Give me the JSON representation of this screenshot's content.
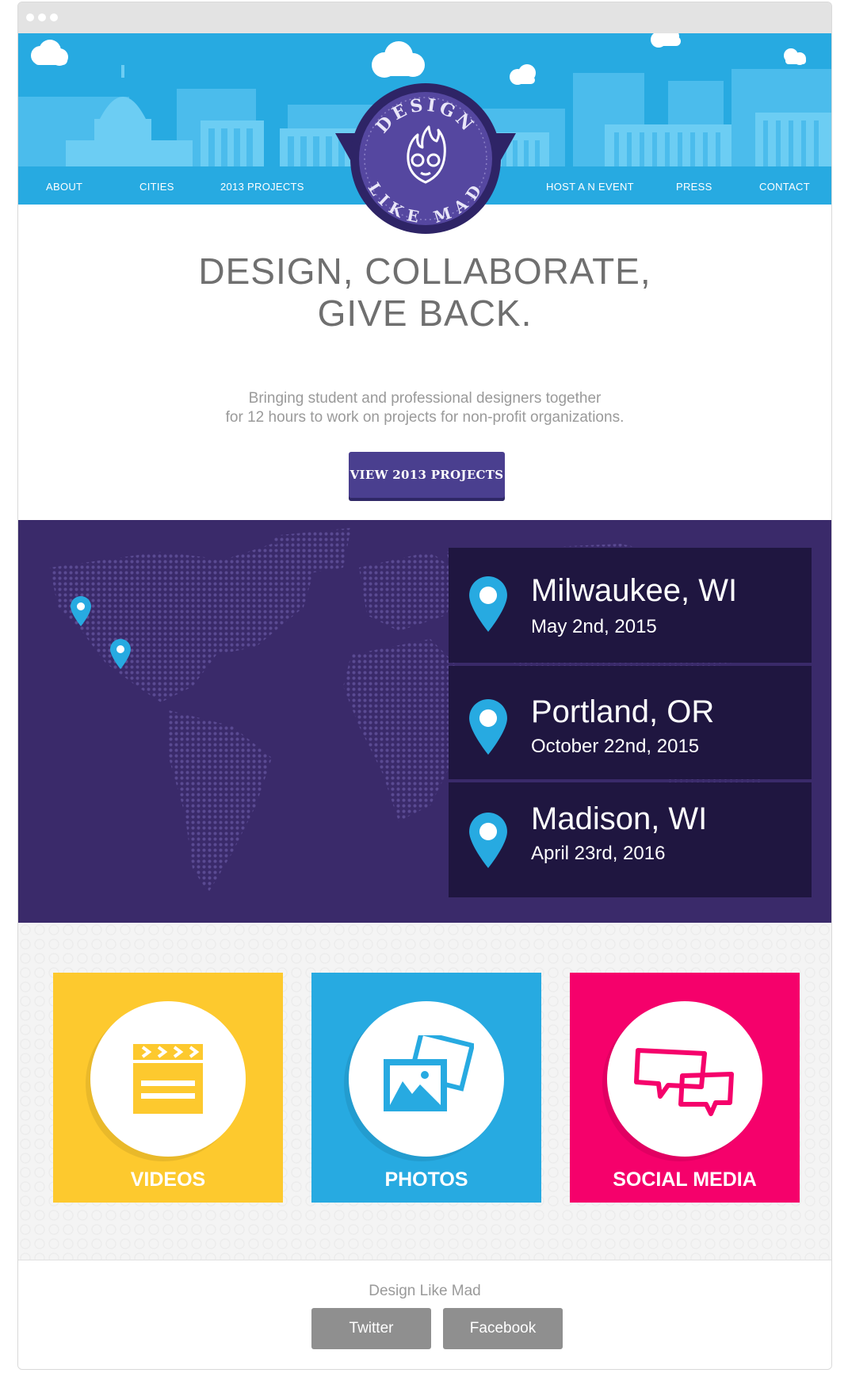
{
  "nav": {
    "about": "ABOUT",
    "cities": "CITIES",
    "projects": "2013 PROJECTS",
    "host": "HOST A N EVENT",
    "press": "PRESS",
    "contact": "CONTACT"
  },
  "badge": {
    "top_text": "DESIGN",
    "bottom_text": "LIKE MAD"
  },
  "hero": {
    "title_line1": "DESIGN, COLLABORATE,",
    "title_line2": "GIVE BACK.",
    "subtitle_line1": "Bringing student and professional designers together",
    "subtitle_line2": "for 12 hours to work on projects for non-profit organizations.",
    "cta_label": "VIEW 2013 PROJECTS"
  },
  "events": [
    {
      "city": "Milwaukee, WI",
      "date": "May 2nd, 2015"
    },
    {
      "city": "Portland, OR",
      "date": "October 22nd, 2015"
    },
    {
      "city": "Madison, WI",
      "date": "April 23rd, 2016"
    }
  ],
  "tiles": {
    "videos": "VIDEOS",
    "photos": "PHOTOS",
    "social": "SOCIAL MEDIA"
  },
  "footer": {
    "name": "Design Like Mad",
    "twitter": "Twitter",
    "facebook": "Facebook"
  },
  "colors": {
    "header_blue": "#27aae1",
    "purple": "#4a3f8f",
    "map_bg": "#3a2a6a",
    "videos_yellow": "#fdc92e",
    "photos_blue": "#27aae1",
    "social_pink": "#f5016b"
  },
  "icons": {
    "browser_dots": "window-control-icon",
    "badge": "flame-logo-icon",
    "map_pin": "location-pin-icon",
    "videos": "clapperboard-icon",
    "photos": "photos-icon",
    "social": "speech-bubbles-icon"
  }
}
